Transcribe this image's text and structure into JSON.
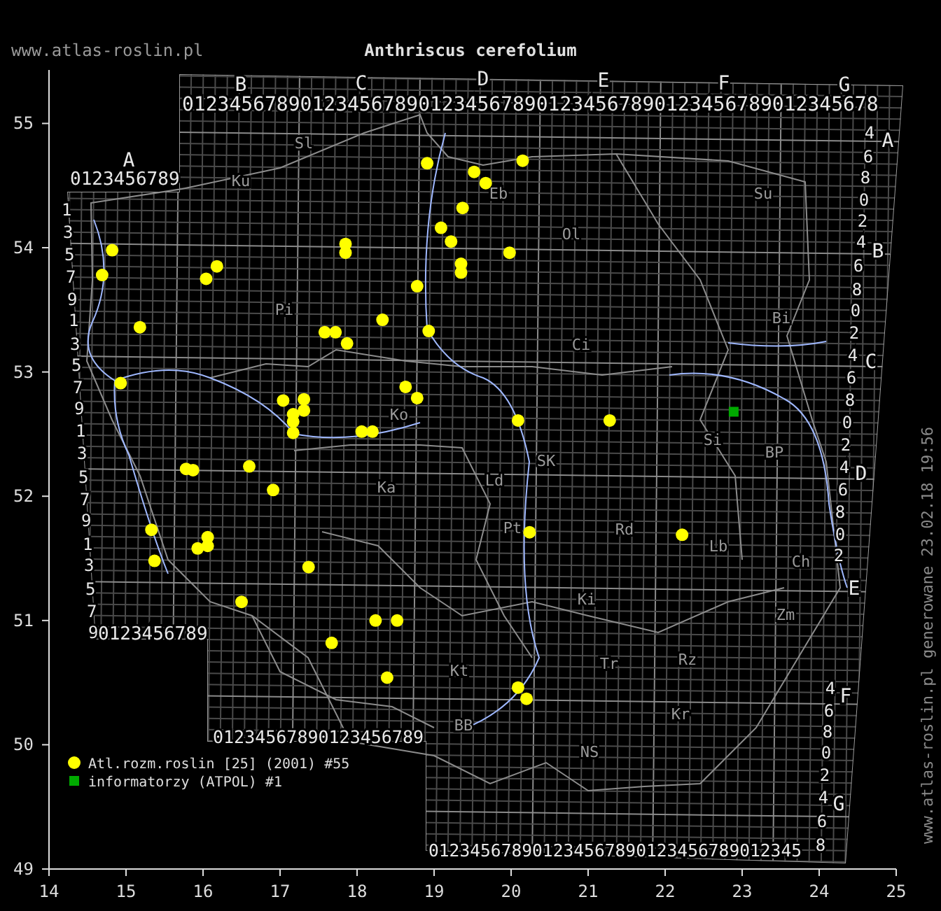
{
  "site_url": "www.atlas-roslin.pl",
  "title": "Anthriscus cerefolium",
  "footer": "www.atlas-roslin.pl generowane 23.02.18 19:56",
  "map": {
    "top_letters": [
      "B",
      "C",
      "D",
      "E",
      "F",
      "G"
    ],
    "top_digits": "01234567890123456789012345678901234567890123456789012345678",
    "left_letter": "A",
    "left_letter_digits": "0123456789",
    "left_digits": [
      "1",
      "3",
      "5",
      "7",
      "9",
      "1",
      "3",
      "5",
      "7",
      "9",
      "1",
      "3",
      "5",
      "7",
      "9",
      "1",
      "3",
      "5",
      "7",
      "9"
    ],
    "bottom_left_digits": "0123456789",
    "bottom_middle_digits": "01234567890123456789",
    "bottom_right_digits": "012345678901234567890123456789012345",
    "right_labels": [
      {
        "text": "4",
        "kind": "digit"
      },
      {
        "text": "A",
        "kind": "letter"
      },
      {
        "text": "6",
        "kind": "digit"
      },
      {
        "text": "8",
        "kind": "digit"
      },
      {
        "text": "0",
        "kind": "digit"
      },
      {
        "text": "2",
        "kind": "digit"
      },
      {
        "text": "4",
        "kind": "digit"
      },
      {
        "text": "B",
        "kind": "letter"
      },
      {
        "text": "6",
        "kind": "digit"
      },
      {
        "text": "8",
        "kind": "digit"
      },
      {
        "text": "0",
        "kind": "digit"
      },
      {
        "text": "2",
        "kind": "digit"
      },
      {
        "text": "4",
        "kind": "digit"
      },
      {
        "text": "C",
        "kind": "letter"
      },
      {
        "text": "6",
        "kind": "digit"
      },
      {
        "text": "8",
        "kind": "digit"
      },
      {
        "text": "0",
        "kind": "digit"
      },
      {
        "text": "2",
        "kind": "digit"
      },
      {
        "text": "4",
        "kind": "digit"
      },
      {
        "text": "D",
        "kind": "letter"
      },
      {
        "text": "6",
        "kind": "digit"
      },
      {
        "text": "8",
        "kind": "digit"
      },
      {
        "text": "0",
        "kind": "digit"
      },
      {
        "text": "2",
        "kind": "digit"
      },
      {
        "text": "E",
        "kind": "letter"
      },
      {
        "text": "4",
        "kind": "digit"
      },
      {
        "text": "F",
        "kind": "letter"
      },
      {
        "text": "6",
        "kind": "digit"
      },
      {
        "text": "8",
        "kind": "digit"
      },
      {
        "text": "0",
        "kind": "digit"
      },
      {
        "text": "2",
        "kind": "digit"
      },
      {
        "text": "4",
        "kind": "digit"
      },
      {
        "text": "G",
        "kind": "letter"
      },
      {
        "text": "6",
        "kind": "digit"
      },
      {
        "text": "8",
        "kind": "digit"
      }
    ],
    "regions": [
      "Sl",
      "Ku",
      "Eb",
      "Ol",
      "Su",
      "Bi",
      "Pi",
      "Ci",
      "Si",
      "BP",
      "SK",
      "Ld",
      "Ko",
      "Ka",
      "Pt",
      "Rd",
      "Lb",
      "Ch",
      "Zm",
      "Ki",
      "Kt",
      "Tr",
      "Rz",
      "Kr",
      "BB",
      "NS"
    ],
    "chart_data": {
      "type": "scatter",
      "xlim": [
        14,
        25
      ],
      "ylim": [
        49,
        55.4
      ],
      "xticks": [
        {
          "value": 14,
          "label": "14"
        },
        {
          "value": 15,
          "label": "15"
        },
        {
          "value": 16,
          "label": "16"
        },
        {
          "value": 17,
          "label": "17"
        },
        {
          "value": 18,
          "label": "18"
        },
        {
          "value": 19,
          "label": "19"
        },
        {
          "value": 20,
          "label": "20"
        },
        {
          "value": 21,
          "label": "21"
        },
        {
          "value": 22,
          "label": "22"
        },
        {
          "value": 23,
          "label": "23"
        },
        {
          "value": 24,
          "label": "24"
        },
        {
          "value": 25,
          "label": "25"
        }
      ],
      "yticks": [
        {
          "value": 49,
          "label": "49"
        },
        {
          "value": 50,
          "label": "50"
        },
        {
          "value": 51,
          "label": "51"
        },
        {
          "value": 52,
          "label": "52"
        },
        {
          "value": 53,
          "label": "53"
        },
        {
          "value": 54,
          "label": "54"
        },
        {
          "value": 55,
          "label": "55"
        }
      ],
      "series": [
        {
          "name": "Atl.rozm.roslin [25] (2001) #55",
          "color": "#ffff00",
          "x": [
            14.82,
            14.69,
            15.18,
            14.93,
            16.18,
            16.04,
            17.85,
            17.85,
            18.91,
            19.52,
            19.67,
            20.15,
            19.09,
            19.22,
            19.37,
            19.35,
            19.35,
            19.98,
            18.78,
            18.33,
            17.58,
            17.72,
            17.87,
            18.93,
            18.63,
            18.78,
            17.04,
            17.31,
            17.31,
            17.17,
            17.17,
            17.17,
            18.06,
            18.2,
            20.09,
            21.28,
            16.6,
            15.78,
            15.87,
            16.91,
            15.33,
            16.06,
            16.06,
            15.93,
            15.37,
            17.37,
            20.24,
            22.22,
            16.5,
            18.24,
            18.52,
            17.67,
            18.39,
            20.09,
            20.2
          ],
          "values": [
            53.98,
            53.78,
            53.36,
            52.91,
            53.85,
            53.75,
            54.03,
            53.96,
            54.68,
            54.61,
            54.52,
            54.7,
            54.16,
            54.05,
            54.32,
            53.87,
            53.8,
            53.96,
            53.69,
            53.42,
            53.32,
            53.32,
            53.23,
            53.33,
            52.88,
            52.79,
            52.77,
            52.78,
            52.69,
            52.66,
            52.6,
            52.51,
            52.52,
            52.52,
            52.61,
            52.61,
            52.24,
            52.22,
            52.21,
            52.05,
            51.73,
            51.67,
            51.6,
            51.58,
            51.48,
            51.43,
            51.71,
            51.69,
            51.15,
            51.0,
            51.0,
            50.82,
            50.54,
            50.46,
            50.37
          ]
        },
        {
          "name": "informatorzy (ATPOL) #1",
          "color": "#00aa00",
          "x": [
            22.89
          ],
          "values": [
            52.68
          ]
        }
      ],
      "legend": true
    }
  }
}
